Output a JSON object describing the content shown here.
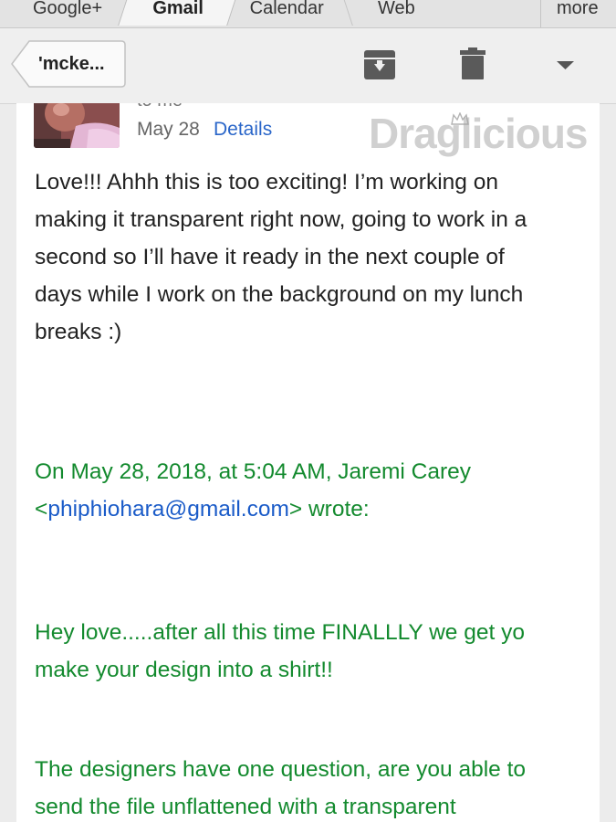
{
  "tabs": {
    "google_plus": "Google+",
    "gmail": "Gmail",
    "calendar": "Calendar",
    "web": "Web",
    "more": "more"
  },
  "toolbar": {
    "back_label": "'mcke...",
    "icons": [
      "archive-icon",
      "trash-icon",
      "dropdown-arrow-icon"
    ]
  },
  "message": {
    "to_line": "to me",
    "date": "May 28",
    "details_link": "Details",
    "body_lines": [
      "Love!!! Ahhh this is too exciting! I’m working on",
      "making it transparent right now, going to work in a",
      "second so I’ll have it ready in the next couple of",
      "days while I work on the background on my lunch",
      "breaks :)"
    ]
  },
  "quoted": {
    "header_line1": "On May 28, 2018, at 5:04 AM, Jaremi Carey",
    "lt": "<",
    "email": "phiphiohara@gmail.com",
    "header_tail": "> wrote:",
    "para1_lines": [
      "Hey love.....after all this time FINALLLY we get yo",
      "make your design into a shirt!!"
    ],
    "para2_lines": [
      "The designers have one question, are you able to",
      "send the file unflattened with a transparent"
    ]
  },
  "watermark": {
    "text": "Draglicious"
  },
  "colors": {
    "quote_green": "#138a2e",
    "link_blue": "#2a66c9"
  }
}
